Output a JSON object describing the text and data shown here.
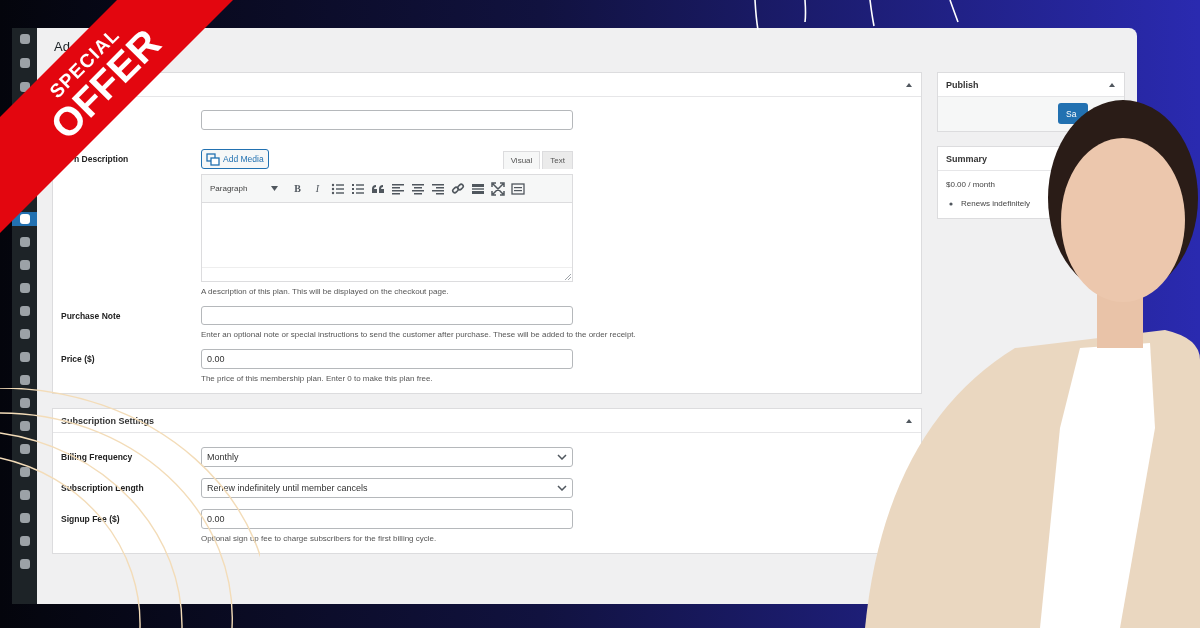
{
  "ribbon": {
    "line_1": "SPECIAL",
    "line_2": "OFFER"
  },
  "admin_menu_top": [
    {
      "selected": false
    },
    {
      "selected": false
    },
    {
      "selected": false
    }
  ],
  "admin_menu_bottom": [
    {
      "selected": true
    },
    {
      "selected": false
    },
    {
      "selected": false
    },
    {
      "selected": false
    },
    {
      "selected": false
    },
    {
      "selected": false
    },
    {
      "selected": false
    },
    {
      "selected": false
    },
    {
      "selected": false
    },
    {
      "selected": false
    },
    {
      "selected": false
    },
    {
      "selected": false
    },
    {
      "selected": false
    },
    {
      "selected": false
    },
    {
      "selected": false
    },
    {
      "selected": false
    }
  ],
  "page_title": "Ad",
  "plan_box": {
    "description": {
      "label": "n Description",
      "add_media": "Add Media",
      "tabs": [
        {
          "label": "Visual",
          "selected": true
        },
        {
          "label": "Text",
          "selected": false
        }
      ],
      "format_select": "Paragraph",
      "toolbar": [
        {
          "kind": "bold",
          "label": "B"
        },
        {
          "kind": "italic",
          "label": "I"
        },
        {
          "kind": "bullets"
        },
        {
          "kind": "numbers"
        },
        {
          "kind": "quote"
        },
        {
          "kind": "align-left"
        },
        {
          "kind": "align-center"
        },
        {
          "kind": "align-right"
        },
        {
          "kind": "link"
        },
        {
          "kind": "more"
        },
        {
          "kind": "fullscreen"
        },
        {
          "kind": "kitchen"
        }
      ],
      "hint": "A description of this plan. This will be displayed on the checkout page."
    },
    "fields": [
      {
        "kind": "textarea",
        "label": "Purchase Note",
        "hint": "Enter an optional note or special instructions to send the customer after purchase. These will be added to the order receipt."
      },
      {
        "kind": "text",
        "label": "Price ($)",
        "value": "0.00",
        "hint": "The price of this membership plan. Enter 0 to make this plan free."
      }
    ]
  },
  "subscription_box": {
    "title": "Subscription Settings",
    "fields": [
      {
        "kind": "select",
        "label": "Billing Frequency",
        "value": "Monthly"
      },
      {
        "kind": "select",
        "label": "Subscription Length",
        "value": "Renew indefinitely until member cancels"
      },
      {
        "kind": "text",
        "label": "Signup Fee ($)",
        "value": "0.00",
        "hint": "Optional sign up fee to charge subscribers for the first billing cycle."
      }
    ]
  },
  "publish_box": {
    "title": "Publish",
    "button": "Sa"
  },
  "summary_box": {
    "title": "Summary",
    "price": "$0.00 / month",
    "items": [
      "Renews indefinitely"
    ]
  }
}
